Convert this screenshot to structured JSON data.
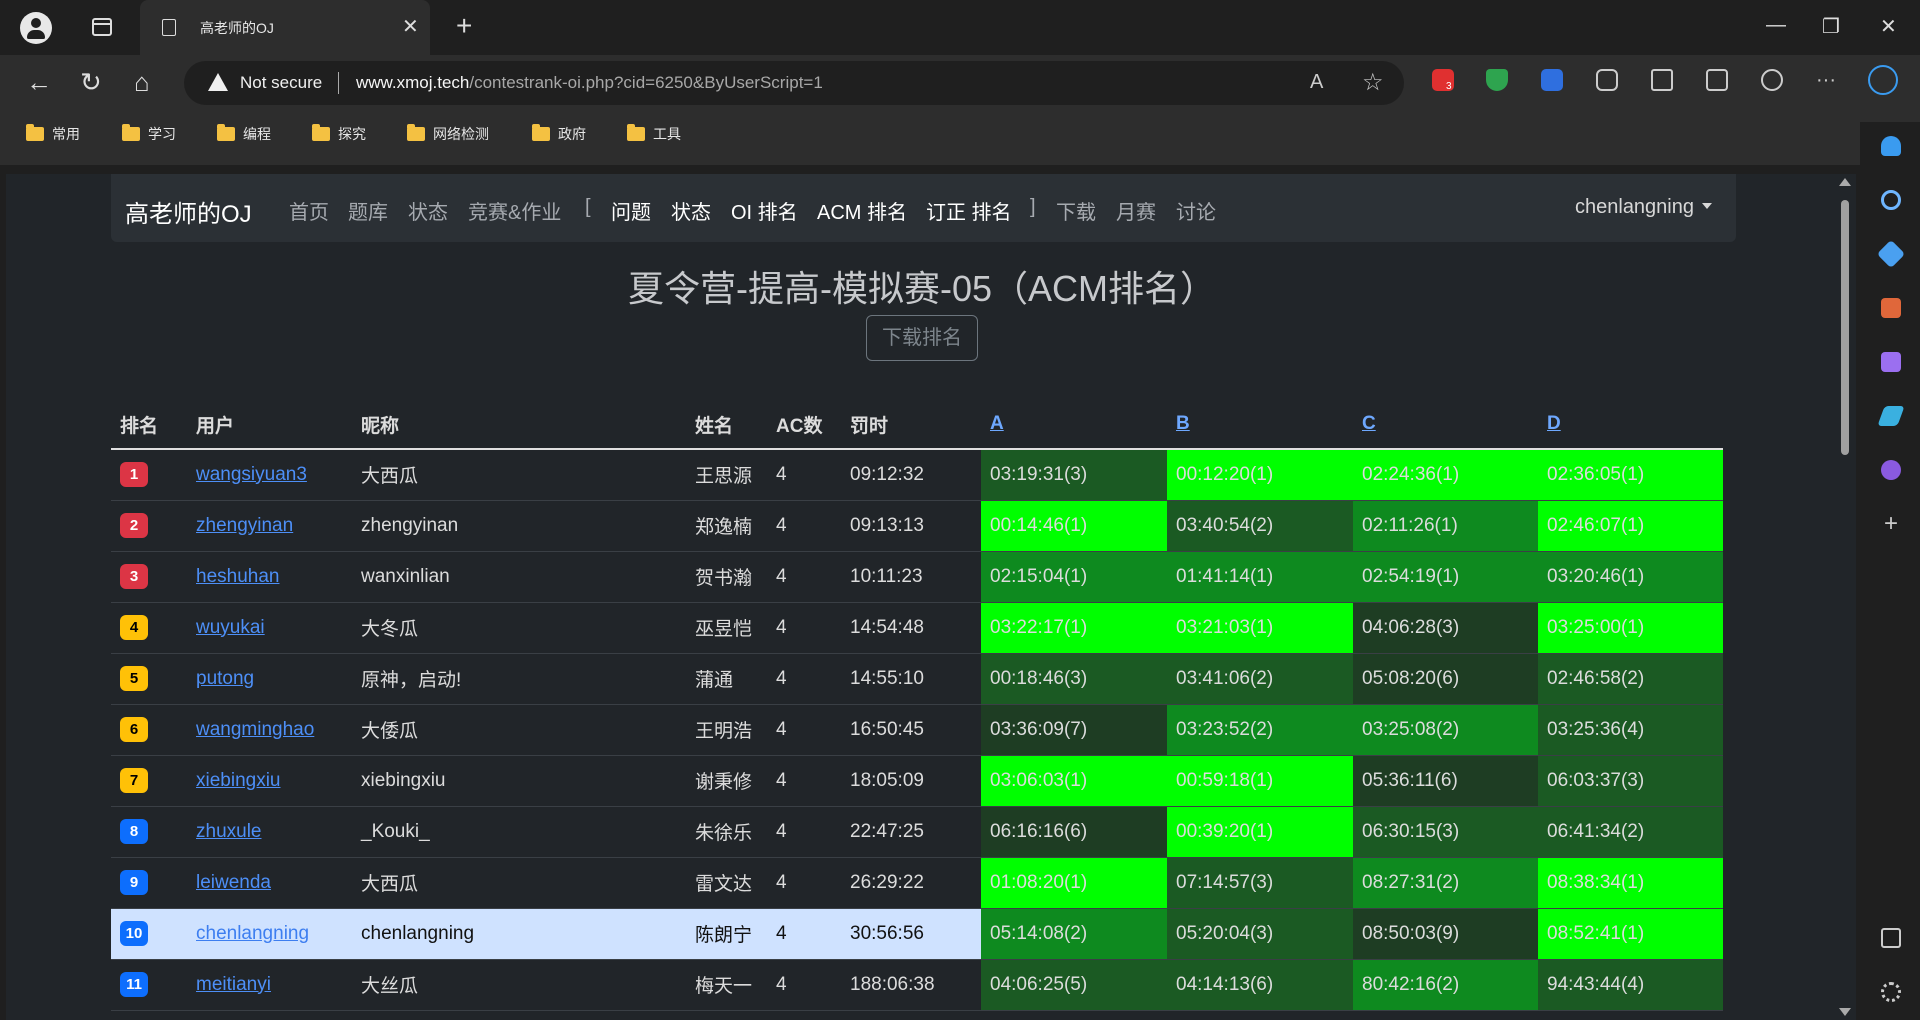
{
  "browser": {
    "tab_title": "高老师的OJ",
    "tab_close": "✕",
    "new_tab": "+",
    "window": {
      "minimize": "—",
      "maximize": "❐",
      "close": "✕"
    },
    "nav": {
      "back": "←",
      "reload": "↻",
      "home": "⌂"
    },
    "not_secure": "Not secure",
    "url_host": "www.xmoj.tech",
    "url_path": "/contestrank-oi.php?cid=6250&ByUserScript=1",
    "read_aloud": "A",
    "favorite": "☆",
    "more": "···",
    "ext_badge": "3",
    "bookmarks": [
      "常用",
      "学习",
      "编程",
      "探究",
      "网络检测",
      "政府",
      "工具"
    ]
  },
  "site": {
    "brand": "高老师的OJ",
    "nav": [
      "首页",
      "题库",
      "状态",
      "竞赛&作业"
    ],
    "bracket_open": "[",
    "contest_nav": [
      "问题",
      "状态",
      "OI 排名",
      "ACM 排名",
      "订正 排名"
    ],
    "bracket_close": "]",
    "nav_right": [
      "下载",
      "月赛",
      "讨论"
    ],
    "user": "chenlangning"
  },
  "contest": {
    "title": "夏令营-提高-模拟赛-05（ACM排名）",
    "download_label": "下载排名"
  },
  "table": {
    "headers": [
      "排名",
      "用户",
      "昵称",
      "姓名",
      "AC数",
      "罚时",
      "A",
      "B",
      "C",
      "D"
    ],
    "rows": [
      {
        "rank": "1",
        "user": "wangsiyuan3",
        "nick": "大西瓜",
        "name": "王思源",
        "ac": "4",
        "penalty": "09:12:32",
        "cells": [
          "03:19:31(3)",
          "00:12:20(1)",
          "02:24:36(1)",
          "02:36:05(1)"
        ]
      },
      {
        "rank": "2",
        "user": "zhengyinan",
        "nick": "zhengyinan",
        "name": "郑逸楠",
        "ac": "4",
        "penalty": "09:13:13",
        "cells": [
          "00:14:46(1)",
          "03:40:54(2)",
          "02:11:26(1)",
          "02:46:07(1)"
        ]
      },
      {
        "rank": "3",
        "user": "heshuhan",
        "nick": "wanxinlian",
        "name": "贺书瀚",
        "ac": "4",
        "penalty": "10:11:23",
        "cells": [
          "02:15:04(1)",
          "01:41:14(1)",
          "02:54:19(1)",
          "03:20:46(1)"
        ]
      },
      {
        "rank": "4",
        "user": "wuyukai",
        "nick": "大冬瓜",
        "name": "巫昱恺",
        "ac": "4",
        "penalty": "14:54:48",
        "cells": [
          "03:22:17(1)",
          "03:21:03(1)",
          "04:06:28(3)",
          "03:25:00(1)"
        ]
      },
      {
        "rank": "5",
        "user": "putong",
        "nick": "原神，启动!",
        "name": "蒲通",
        "ac": "4",
        "penalty": "14:55:10",
        "cells": [
          "00:18:46(3)",
          "03:41:06(2)",
          "05:08:20(6)",
          "02:46:58(2)"
        ]
      },
      {
        "rank": "6",
        "user": "wangminghao",
        "nick": "大倭瓜",
        "name": "王明浩",
        "ac": "4",
        "penalty": "16:50:45",
        "cells": [
          "03:36:09(7)",
          "03:23:52(2)",
          "03:25:08(2)",
          "03:25:36(4)"
        ]
      },
      {
        "rank": "7",
        "user": "xiebingxiu",
        "nick": "xiebingxiu",
        "name": "谢秉修",
        "ac": "4",
        "penalty": "18:05:09",
        "cells": [
          "03:06:03(1)",
          "00:59:18(1)",
          "05:36:11(6)",
          "06:03:37(3)"
        ]
      },
      {
        "rank": "8",
        "user": "zhuxule",
        "nick": "_Kouki_",
        "name": "朱徐乐",
        "ac": "4",
        "penalty": "22:47:25",
        "cells": [
          "06:16:16(6)",
          "00:39:20(1)",
          "06:30:15(3)",
          "06:41:34(2)"
        ]
      },
      {
        "rank": "9",
        "user": "leiwenda",
        "nick": "大西瓜",
        "name": "雷文达",
        "ac": "4",
        "penalty": "26:29:22",
        "cells": [
          "01:08:20(1)",
          "07:14:57(3)",
          "08:27:31(2)",
          "08:38:34(1)"
        ]
      },
      {
        "rank": "10",
        "user": "chenlangning",
        "nick": "chenlangning",
        "name": "陈朗宁",
        "ac": "4",
        "penalty": "30:56:56",
        "cells": [
          "05:14:08(2)",
          "05:20:04(3)",
          "08:50:03(9)",
          "08:52:41(1)"
        ]
      },
      {
        "rank": "11",
        "user": "meitianyi",
        "nick": "大丝瓜",
        "name": "梅天一",
        "ac": "4",
        "penalty": "188:06:38",
        "cells": [
          "04:06:25(5)",
          "04:14:13(6)",
          "80:42:16(2)",
          "94:43:44(4)"
        ]
      }
    ],
    "cell_shades": [
      [
        "dark",
        "bright",
        "bright",
        "bright"
      ],
      [
        "bright",
        "dark",
        "mid",
        "bright"
      ],
      [
        "mid",
        "mid",
        "mid",
        "mid"
      ],
      [
        "bright",
        "bright",
        "darker",
        "bright"
      ],
      [
        "dark",
        "dark",
        "darker",
        "dark"
      ],
      [
        "darker",
        "mid",
        "mid",
        "dark"
      ],
      [
        "bright",
        "bright",
        "darker",
        "dark"
      ],
      [
        "darker",
        "bright",
        "dark",
        "dark"
      ],
      [
        "bright",
        "dark",
        "mid",
        "bright"
      ],
      [
        "mid",
        "dark",
        "darker",
        "bright"
      ],
      [
        "dark",
        "dark",
        "mid",
        "dark"
      ]
    ],
    "shade_colors": {
      "bright": "#00ff00",
      "mid": "#0e8a1f",
      "dark": "#1b5a23",
      "darker": "#1e3d23"
    }
  }
}
